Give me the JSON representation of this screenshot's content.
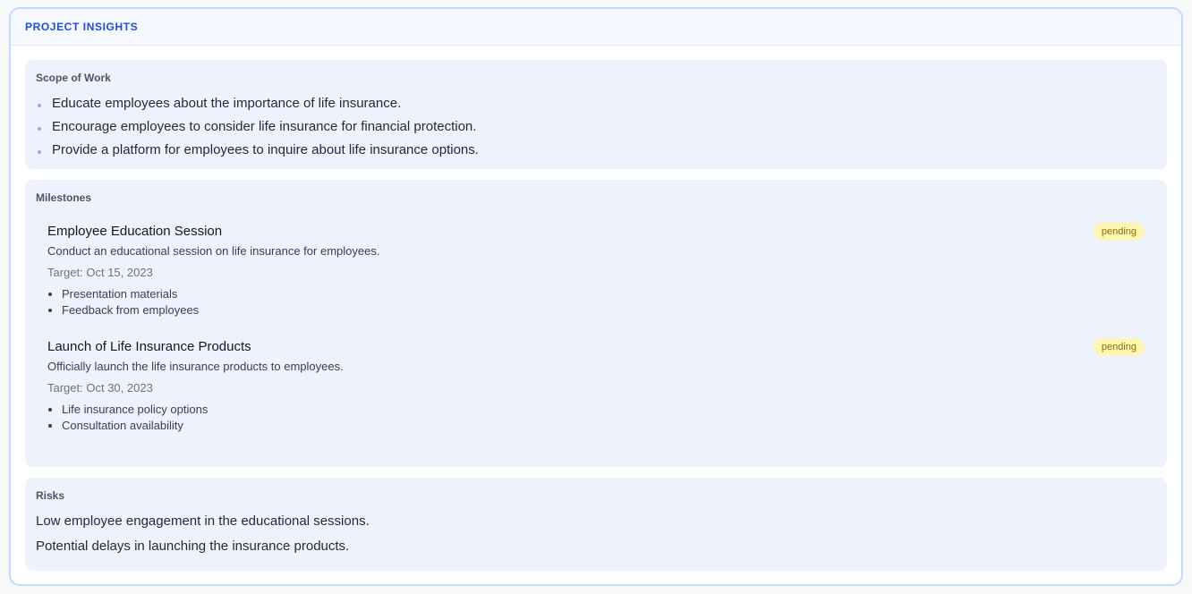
{
  "panel": {
    "title": "PROJECT INSIGHTS"
  },
  "scope": {
    "title": "Scope of Work",
    "items": [
      "Educate employees about the importance of life insurance.",
      "Encourage employees to consider life insurance for financial protection.",
      "Provide a platform for employees to inquire about life insurance options."
    ]
  },
  "milestones": {
    "title": "Milestones",
    "items": [
      {
        "title": "Employee Education Session",
        "description": "Conduct an educational session on life insurance for employees.",
        "target": "Target: Oct 15, 2023",
        "status": "pending",
        "deliverables": [
          "Presentation materials",
          "Feedback from employees"
        ]
      },
      {
        "title": "Launch of Life Insurance Products",
        "description": "Officially launch the life insurance products to employees.",
        "target": "Target: Oct 30, 2023",
        "status": "pending",
        "deliverables": [
          "Life insurance policy options",
          "Consultation availability"
        ]
      }
    ]
  },
  "risks": {
    "title": "Risks",
    "items": [
      "Low employee engagement in the educational sessions.",
      "Potential delays in launching the insurance products."
    ]
  },
  "colors": {
    "accent": "#1d4ed8",
    "panel_border": "#bfdbfe",
    "section_bg": "#eef2fd",
    "badge_bg": "#fdf6b2",
    "badge_text": "#8a6d0b"
  }
}
